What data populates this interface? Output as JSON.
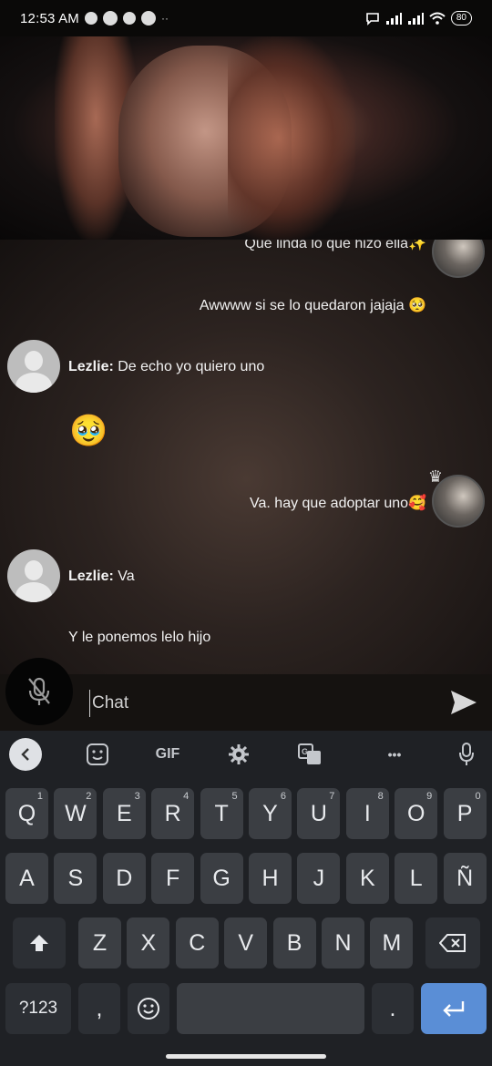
{
  "status_bar": {
    "time": "12:53 AM",
    "battery": "80"
  },
  "chat": {
    "messages": [
      {
        "side": "right",
        "text": "Que linda lo que hizo ella✨",
        "partial": true
      },
      {
        "side": "right",
        "text": "Awwww si se lo quedaron jajaja 🥺"
      },
      {
        "side": "left",
        "sender": "Lezlie:",
        "text": "De echo yo quiero uno"
      },
      {
        "side": "left",
        "text": "🥹"
      },
      {
        "side": "right",
        "text": "Va. hay que adoptar uno🥰"
      },
      {
        "side": "left",
        "sender": "Lezlie:",
        "text": "Va"
      },
      {
        "side": "left",
        "text": "Y le ponemos lelo hijo"
      }
    ]
  },
  "input": {
    "placeholder": "Chat"
  },
  "keyboard": {
    "toolbar": [
      "back-icon",
      "sticker-icon",
      "GIF",
      "settings-icon",
      "translate-icon",
      "more-icon",
      "mic-icon"
    ],
    "gif_label": "GIF",
    "more_label": "•••",
    "row1": [
      {
        "k": "Q",
        "n": "1"
      },
      {
        "k": "W",
        "n": "2"
      },
      {
        "k": "E",
        "n": "3"
      },
      {
        "k": "R",
        "n": "4"
      },
      {
        "k": "T",
        "n": "5"
      },
      {
        "k": "Y",
        "n": "6"
      },
      {
        "k": "U",
        "n": "7"
      },
      {
        "k": "I",
        "n": "8"
      },
      {
        "k": "O",
        "n": "9"
      },
      {
        "k": "P",
        "n": "0"
      }
    ],
    "row2": [
      "A",
      "S",
      "D",
      "F",
      "G",
      "H",
      "J",
      "K",
      "L",
      "Ñ"
    ],
    "row3": [
      "Z",
      "X",
      "C",
      "V",
      "B",
      "N",
      "M"
    ],
    "symbols_label": "?123",
    "comma_label": ",",
    "period_label": "."
  }
}
